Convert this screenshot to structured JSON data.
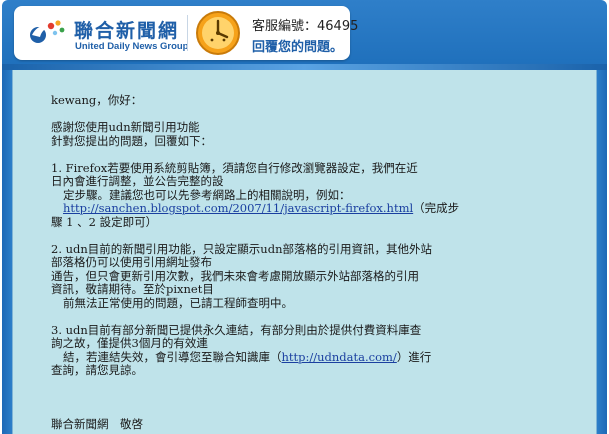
{
  "header": {
    "logo_cn": "聯合新聞網",
    "logo_en": "United Daily News Group",
    "service_id": "客服編號：46495",
    "reply_title": "回覆您的問題。"
  },
  "message": {
    "greeting": "kewang，你好：",
    "intro_1": "感謝您使用udn新聞引用功能",
    "intro_2": "針對您提出的問題，回覆如下：",
    "p1_line1": "1. Firefox若要使用系統剪貼簿，須請您自行修改瀏覽器設定，我們在近",
    "p1_line2": "日內會進行調整，並公告完整的設",
    "p1_line3": "定步驟。建議您也可以先參考網路上的相關說明，例如：",
    "p1_link": "http://sanchen.blogspot.com/2007/11/javascript-firefox.html",
    "p1_after_link": "（完成步",
    "p1_line5": "驟 1 、2 設定即可）",
    "p2_line1": "2. udn目前的新聞引用功能，只設定顯示udn部落格的引用資訊，其他外站",
    "p2_line2": "部落格仍可以使用引用網址發布",
    "p2_line3": "通告，但只會更新引用次數，我們未來會考慮開放顯示外站部落格的引用",
    "p2_line4": "資訊，敬請期待。至於pixnet目",
    "p2_line5": "前無法正常使用的問題，已請工程師查明中。",
    "p3_line1": "3. udn目前有部分新聞已提供永久連結，有部分則由於提供付費資料庫查",
    "p3_line2": "詢之故，僅提供3個月的有效連",
    "p3_line3_pre": "結，若連結失效，會引導您至聯合知識庫（",
    "p3_link": "http://udndata.com/",
    "p3_line3_post": "）進行",
    "p3_line4": "查詢，請您見諒。",
    "signature": "聯合新聞網　敬啓"
  },
  "colors": {
    "header_blue": "#2f7fc9",
    "content_bg": "#bfe3ea",
    "brand_blue": "#1f5fa8",
    "link": "#1a3fa0"
  }
}
